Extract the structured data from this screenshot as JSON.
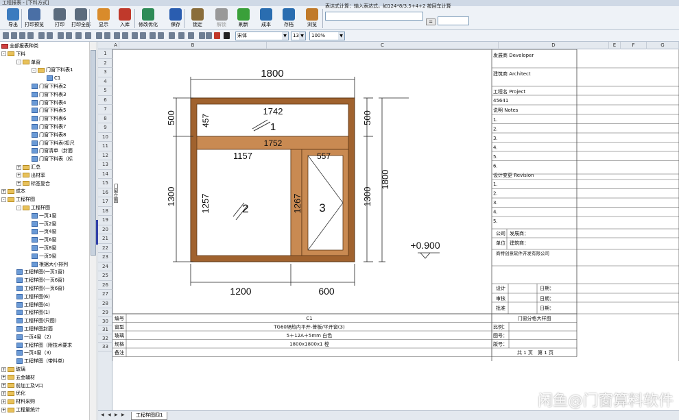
{
  "window": {
    "title": "工程报表 - [下料方式]"
  },
  "toolbar": {
    "buttons": [
      {
        "label": "导出",
        "icon": "export-icon",
        "color": "#3b7bbf"
      },
      {
        "label": "打印预览",
        "icon": "print-preview-icon",
        "color": "#4a6fa5"
      },
      {
        "label": "打印",
        "icon": "print-icon",
        "color": "#5b6b7d"
      },
      {
        "label": "打印全部",
        "icon": "print-all-icon",
        "color": "#5b6b7d"
      },
      {
        "label": "显示",
        "icon": "display-icon",
        "color": "#d98b2b"
      },
      {
        "label": "入库",
        "icon": "stock-in-icon",
        "color": "#c0392b"
      },
      {
        "label": "修改优化",
        "icon": "optimize-icon",
        "color": "#2e8b57"
      },
      {
        "label": "保存",
        "icon": "save-icon",
        "color": "#2a5db0"
      },
      {
        "label": "锁定",
        "icon": "lock-icon",
        "color": "#8a6d3b"
      },
      {
        "label": "解锁",
        "icon": "unlock-icon",
        "color": "#999999"
      },
      {
        "label": "刷新",
        "icon": "refresh-icon",
        "color": "#3aa03a"
      },
      {
        "label": "成本",
        "icon": "cost-icon",
        "color": "#2a6db0"
      },
      {
        "label": "存档",
        "icon": "archive-icon",
        "color": "#2a6db0"
      },
      {
        "label": "浏览",
        "icon": "browse-icon",
        "color": "#c07a2a"
      }
    ],
    "expr_label": "表达式计算：输入表达式，如124*8/3.5+4+2 按回车计算",
    "expr_value": "",
    "eq_label": "=",
    "result_value": ""
  },
  "format": {
    "font": "宋体",
    "size": "13",
    "zoom": "100%"
  },
  "tree": {
    "nodes": [
      {
        "label": "全部报表种类",
        "level": 0,
        "kind": "root"
      },
      {
        "label": "下料",
        "level": 0,
        "kind": "folder",
        "pm": "-"
      },
      {
        "label": "单窗",
        "level": 1,
        "kind": "folder",
        "pm": "-"
      },
      {
        "label": "门窗下料表1",
        "level": 2,
        "kind": "folder",
        "pm": "-"
      },
      {
        "label": "C1",
        "level": 3,
        "kind": "doc"
      },
      {
        "label": "门窗下料表2",
        "level": 2,
        "kind": "doc"
      },
      {
        "label": "门窗下料表3",
        "level": 2,
        "kind": "doc"
      },
      {
        "label": "门窗下料表4",
        "level": 2,
        "kind": "doc"
      },
      {
        "label": "门窗下料表5",
        "level": 2,
        "kind": "doc"
      },
      {
        "label": "门窗下料表6",
        "level": 2,
        "kind": "doc"
      },
      {
        "label": "门窗下料表7",
        "level": 2,
        "kind": "doc"
      },
      {
        "label": "门窗下料表8",
        "level": 2,
        "kind": "doc"
      },
      {
        "label": "门窗下料表(扣尺",
        "level": 2,
        "kind": "doc"
      },
      {
        "label": "门窗清单（封面",
        "level": 2,
        "kind": "doc"
      },
      {
        "label": "门窗下料表（标",
        "level": 2,
        "kind": "doc"
      },
      {
        "label": "汇总",
        "level": 1,
        "kind": "folder",
        "pm": "+"
      },
      {
        "label": "出材率",
        "level": 1,
        "kind": "folder",
        "pm": "+"
      },
      {
        "label": "标签复合",
        "level": 1,
        "kind": "folder",
        "pm": "+"
      },
      {
        "label": "成本",
        "level": 0,
        "kind": "folder",
        "pm": "+"
      },
      {
        "label": "工程样图",
        "level": 0,
        "kind": "folder",
        "pm": "-"
      },
      {
        "label": "工程样图",
        "level": 1,
        "kind": "folder",
        "pm": "-"
      },
      {
        "label": "一页1窗",
        "level": 2,
        "kind": "doc"
      },
      {
        "label": "一页2窗",
        "level": 2,
        "kind": "doc"
      },
      {
        "label": "一页4窗",
        "level": 2,
        "kind": "doc"
      },
      {
        "label": "一页6窗",
        "level": 2,
        "kind": "doc"
      },
      {
        "label": "一页8窗",
        "level": 2,
        "kind": "doc"
      },
      {
        "label": "一页9窗",
        "level": 2,
        "kind": "doc"
      },
      {
        "label": "根据大小排列",
        "level": 2,
        "kind": "doc"
      },
      {
        "label": "工程样图(一页1窗)",
        "level": 1,
        "kind": "doc"
      },
      {
        "label": "工程样图(一页6窗)",
        "level": 1,
        "kind": "doc"
      },
      {
        "label": "工程样图(一页6窗)",
        "level": 1,
        "kind": "doc"
      },
      {
        "label": "工程样图(6)",
        "level": 1,
        "kind": "doc"
      },
      {
        "label": "工程样图(4)",
        "level": 1,
        "kind": "doc"
      },
      {
        "label": "工程样图(1)",
        "level": 1,
        "kind": "doc"
      },
      {
        "label": "工程样图(只图)",
        "level": 1,
        "kind": "doc"
      },
      {
        "label": "工程样图封面",
        "level": 1,
        "kind": "doc"
      },
      {
        "label": "一页4窗（2）",
        "level": 1,
        "kind": "doc"
      },
      {
        "label": "工程样图（附技术要求",
        "level": 1,
        "kind": "doc"
      },
      {
        "label": "一页4窗（3）",
        "level": 1,
        "kind": "doc"
      },
      {
        "label": "工程样图（带料单）",
        "level": 1,
        "kind": "doc"
      },
      {
        "label": "玻璃",
        "level": 0,
        "kind": "folder",
        "pm": "+"
      },
      {
        "label": "五金辅材",
        "level": 0,
        "kind": "folder",
        "pm": "+"
      },
      {
        "label": "前加工及V口",
        "level": 0,
        "kind": "folder",
        "pm": "+"
      },
      {
        "label": "优化",
        "level": 0,
        "kind": "folder",
        "pm": "+"
      },
      {
        "label": "材料采购",
        "level": 0,
        "kind": "folder",
        "pm": "+"
      },
      {
        "label": "工程量统计",
        "level": 0,
        "kind": "folder",
        "pm": "+"
      }
    ]
  },
  "sheet": {
    "columns": [
      "A",
      "B",
      "C",
      "D",
      "E",
      "F",
      "G"
    ],
    "rows": [
      "1",
      "2",
      "3",
      "4",
      "5",
      "6",
      "7",
      "8",
      "9",
      "10",
      "11",
      "12",
      "13",
      "14",
      "15",
      "16",
      "17",
      "18",
      "19",
      "20",
      "21",
      "22",
      "23",
      "24",
      "25",
      "26",
      "27",
      "28",
      "29",
      "30",
      "31",
      "32",
      "33"
    ],
    "drawing": {
      "width": "1800",
      "height": "1800",
      "top_height": "500",
      "bottom_height": "1300",
      "bottom_left_width": "1200",
      "bottom_right_width": "600",
      "transom_width": "1742",
      "transom_height": "457",
      "transom_no": "1",
      "mid_width": "1752",
      "pane2_width": "1157",
      "pane2_height": "1257",
      "pane2_no": "2",
      "pane3_width": "557",
      "pane3_height": "1267",
      "pane3_no": "3",
      "elevation": "+0.900",
      "side_label": "门窗立面"
    },
    "info": {
      "developer": "发展商 Developer",
      "architect": "建筑商 Architect",
      "project": "工程名 Project",
      "project_value": "45641",
      "notes": "说明 Notes",
      "note_items": [
        "1.",
        "2.",
        "3.",
        "4.",
        "5.",
        "6."
      ],
      "revision": "设计变更 Revision",
      "revision_items": [
        "1.",
        "2.",
        "3.",
        "4.",
        "5."
      ],
      "company_k": "公司",
      "company_v": "发展商：",
      "unit_k": "单位",
      "unit_v": "建筑商：",
      "maker": "商特创意软件开发有限公司",
      "design": "设计",
      "check": "审核",
      "approve": "批准",
      "date": "日期："
    },
    "bottom": {
      "num_k": "编号",
      "num_v": "C1",
      "type_k": "窗型",
      "type_v": "TG60隔热内平开-普板/平开窗(3)",
      "glass_k": "玻璃",
      "glass_v": "5＋12A＋5mm 白色",
      "spec_k": "规格",
      "spec_v": "1800x1800x1 樘",
      "remark_k": "备注",
      "title": "门窗分格大样图",
      "scale": "比例：",
      "drawing_no": "图号：",
      "version": "版号：",
      "pages": "共 1 页",
      "page": "第 1 页"
    }
  },
  "tabs": {
    "sheet1": "工程样图四1"
  },
  "watermark": "闲鱼@门窗算料软件"
}
